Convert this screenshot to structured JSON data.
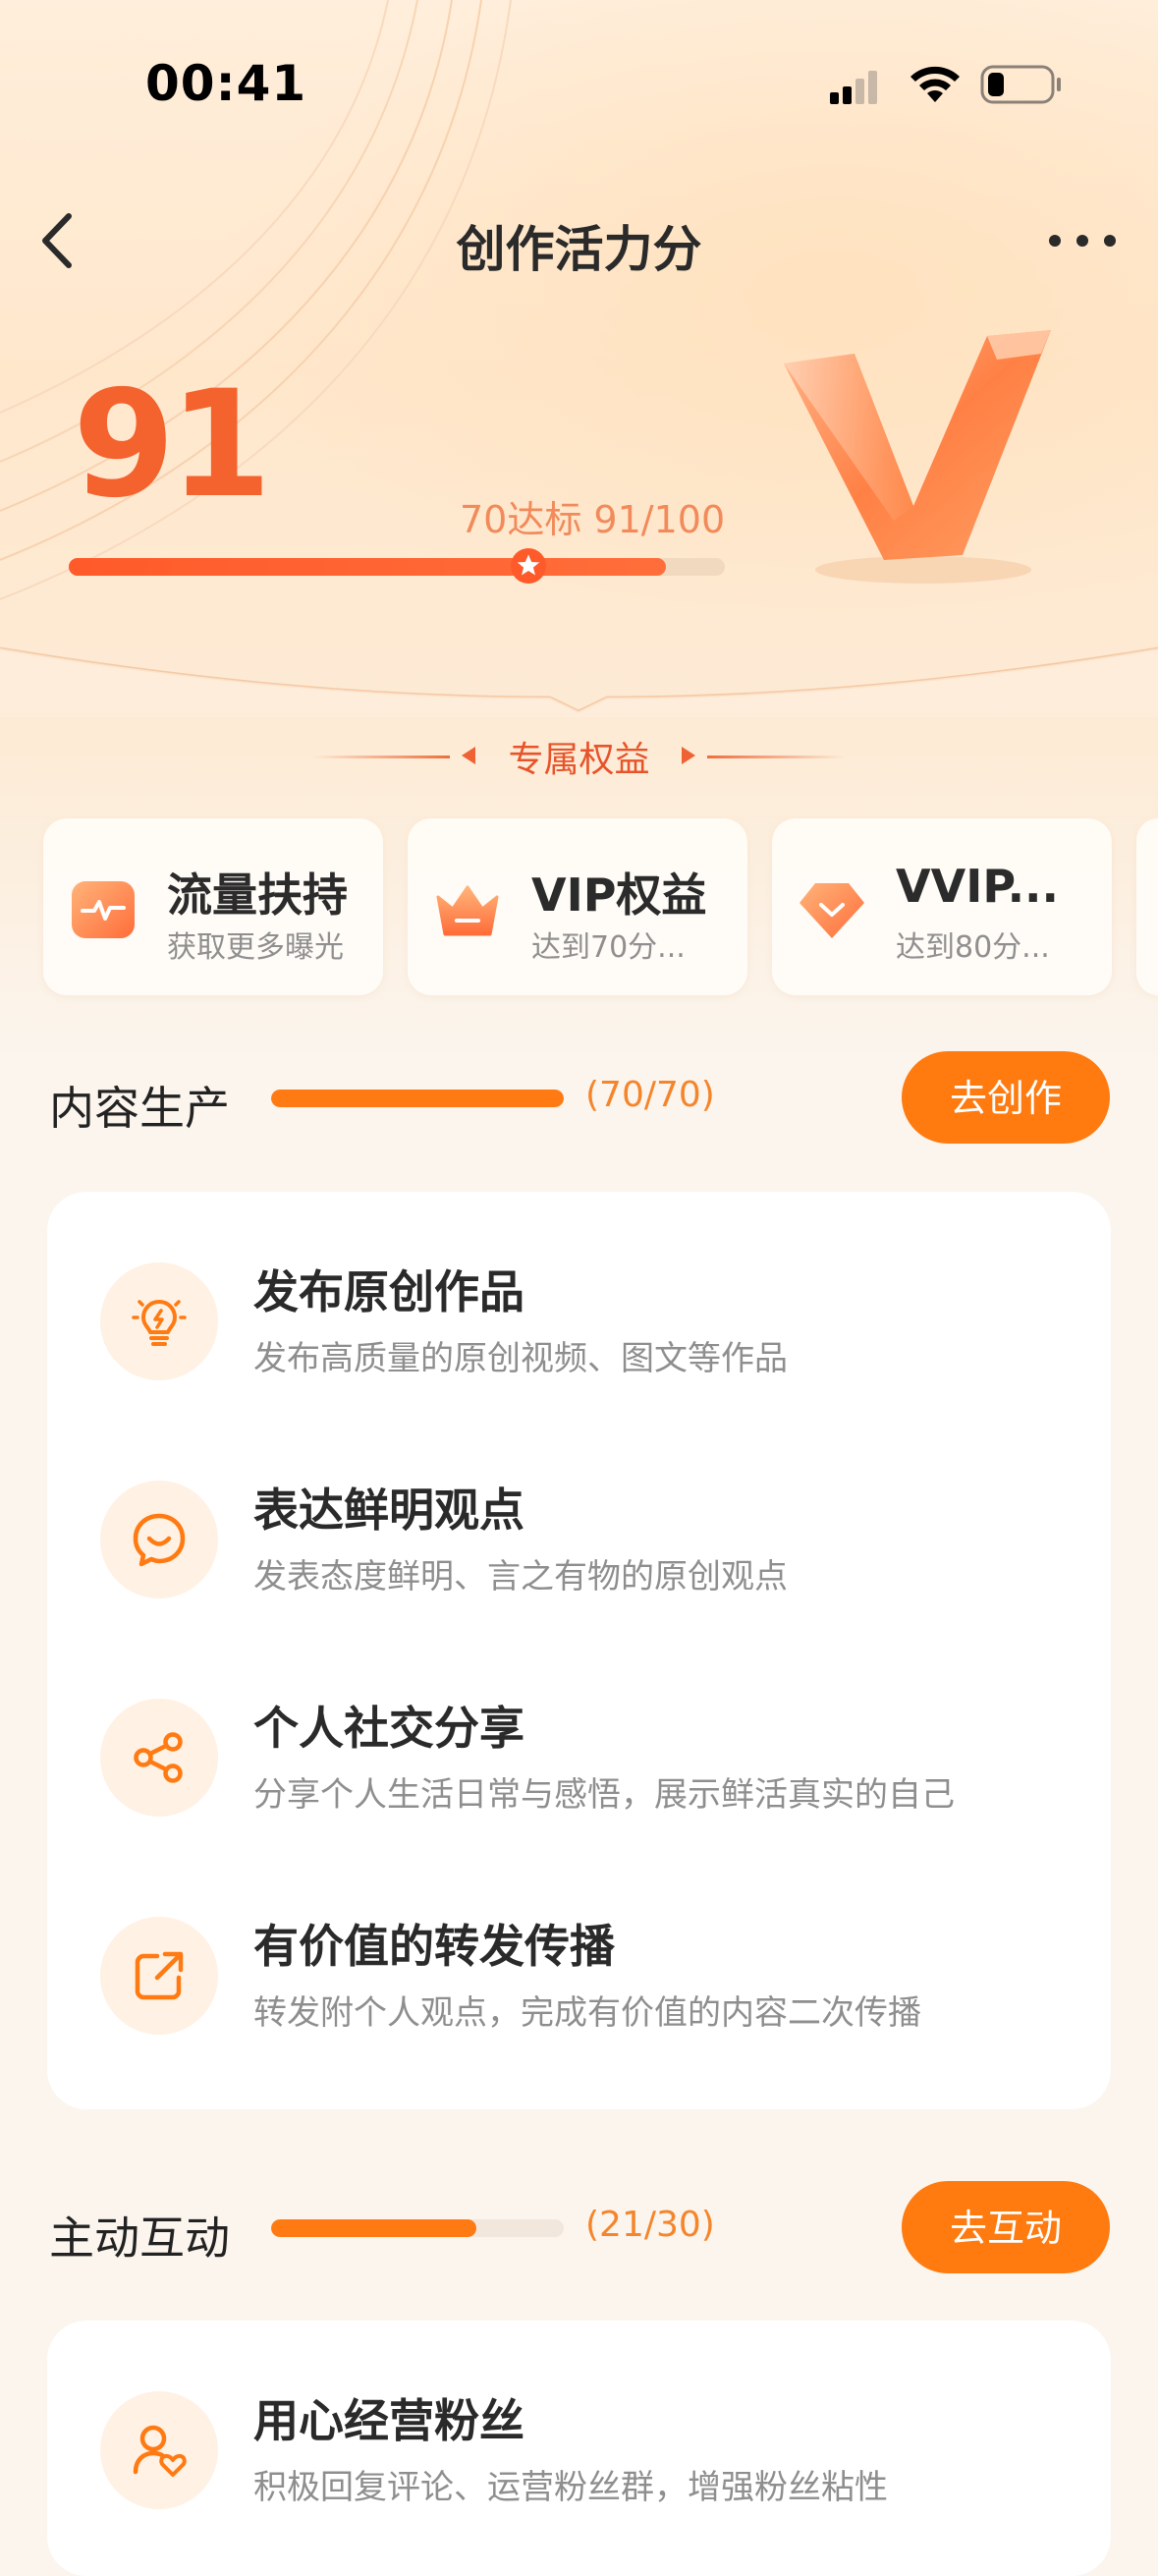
{
  "status_bar": {
    "time": "00:41"
  },
  "nav": {
    "title": "创作活力分"
  },
  "score": {
    "value": "91",
    "progress_text": "70达标 91/100",
    "progress_fraction": 0.91,
    "threshold_fraction": 0.7
  },
  "benefits": {
    "title": "专属权益",
    "items": [
      {
        "title": "流量扶持",
        "subtitle": "获取更多曝光",
        "icon": "traffic-icon"
      },
      {
        "title": "VIP权益",
        "subtitle": "达到70分...",
        "icon": "crown-icon"
      },
      {
        "title": "VVIP...",
        "subtitle": "达到80分...",
        "icon": "diamond-icon"
      }
    ]
  },
  "sections": {
    "content": {
      "title": "内容生产",
      "count": "(70/70)",
      "progress_fraction": 1.0,
      "button": "去创作",
      "tasks": [
        {
          "title": "发布原创作品",
          "desc": "发布高质量的原创视频、图文等作品",
          "icon": "lightbulb-icon"
        },
        {
          "title": "表达鲜明观点",
          "desc": "发表态度鲜明、言之有物的原创观点",
          "icon": "smile-chat-icon"
        },
        {
          "title": "个人社交分享",
          "desc": "分享个人生活日常与感悟，展示鲜活真实的自己",
          "icon": "share-icon"
        },
        {
          "title": "有价值的转发传播",
          "desc": "转发附个人观点，完成有价值的内容二次传播",
          "icon": "forward-icon"
        }
      ]
    },
    "interaction": {
      "title": "主动互动",
      "count": "(21/30)",
      "progress_fraction": 0.7,
      "button": "去互动",
      "tasks": [
        {
          "title": "用心经营粉丝",
          "desc": "积极回复评论、运营粉丝群，增强粉丝粘性",
          "icon": "fan-heart-icon"
        }
      ]
    }
  },
  "colors": {
    "accent": "#ff7a0f",
    "score": "#f4622e",
    "icon_bg": "#fff1e3"
  }
}
